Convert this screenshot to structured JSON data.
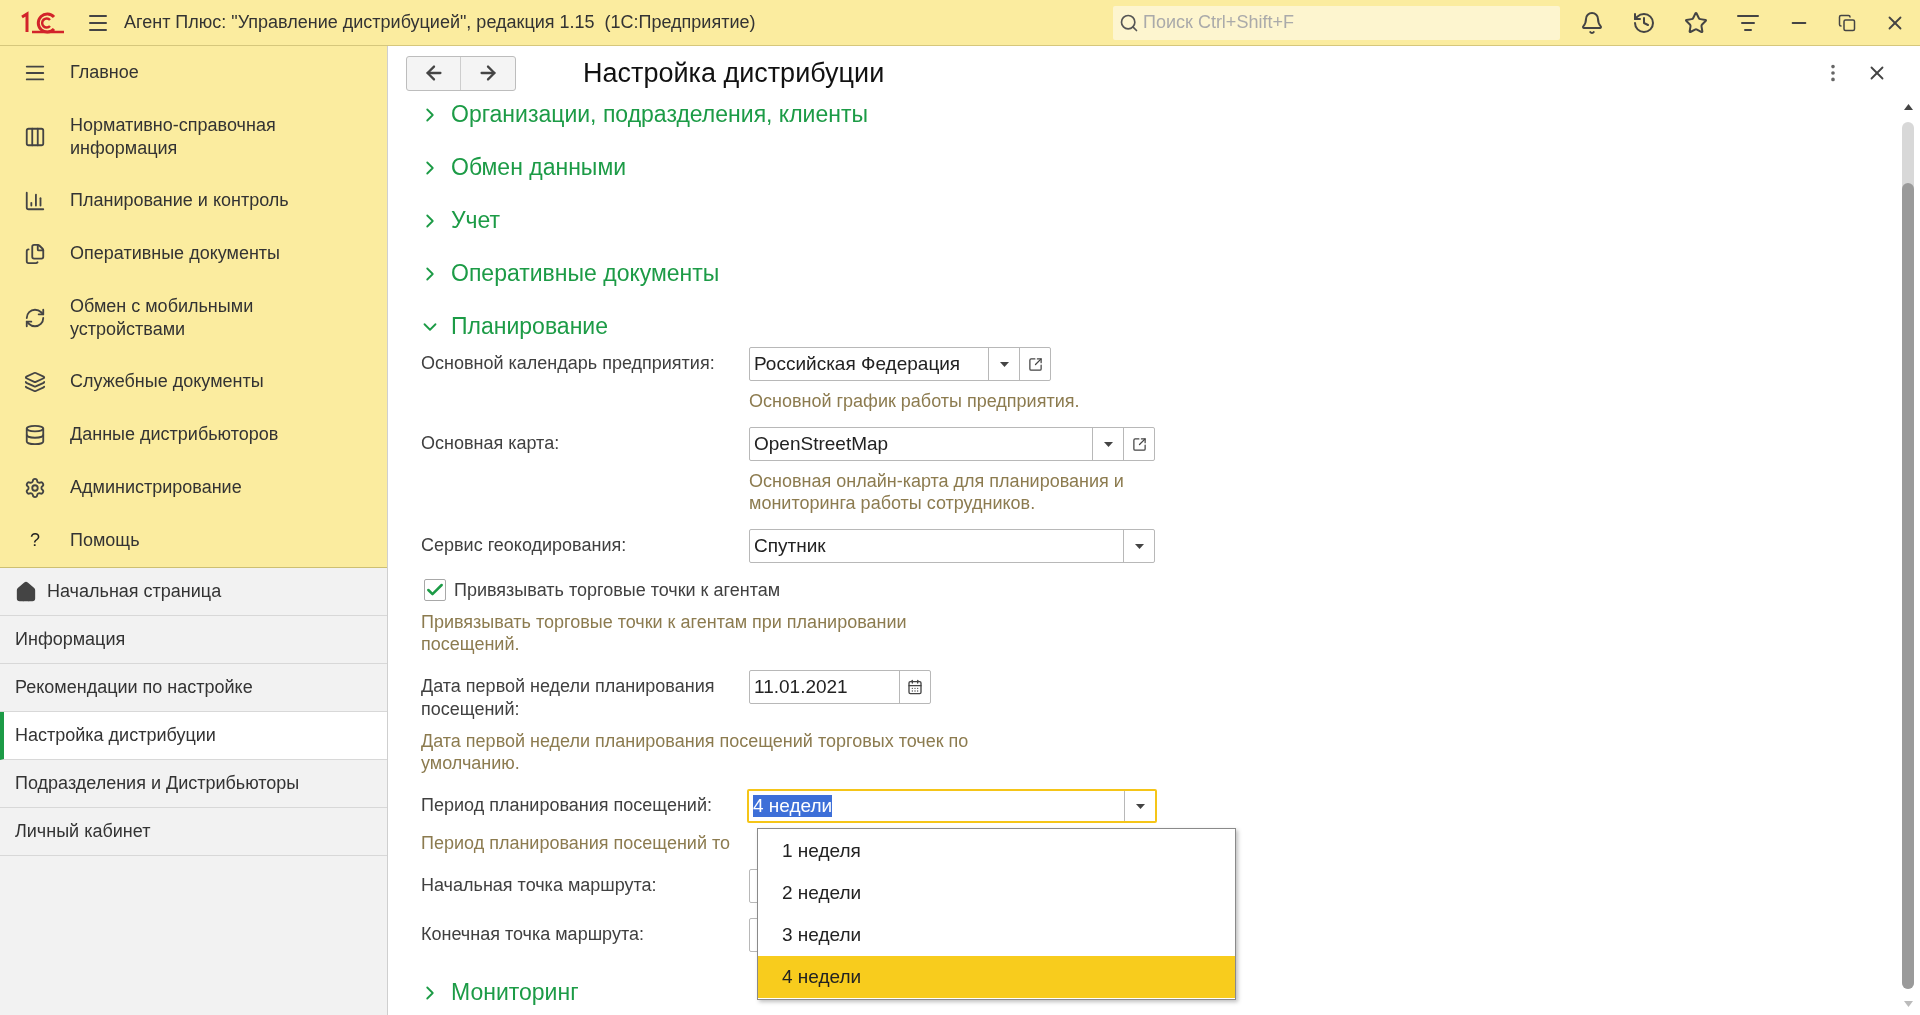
{
  "window": {
    "title": "Агент Плюс: \"Управление дистрибуцией\", редакция 1.15  (1С:Предприятие)",
    "search": {
      "placeholder": "Поиск Ctrl+Shift+F"
    }
  },
  "sidebar": {
    "sections": [
      {
        "label": "Главное"
      },
      {
        "label": "Нормативно-справочная информация"
      },
      {
        "label": "Планирование и контроль"
      },
      {
        "label": "Оперативные документы"
      },
      {
        "label": "Обмен с мобильными устройствами"
      },
      {
        "label": "Служебные документы"
      },
      {
        "label": "Данные дистрибьюторов"
      },
      {
        "label": "Администрирование"
      },
      {
        "label": "Помощь",
        "glyph": "?"
      }
    ],
    "pages": [
      {
        "label": "Начальная страница",
        "selected": false
      },
      {
        "label": "Информация",
        "selected": false
      },
      {
        "label": "Рекомендации по настройке",
        "selected": false
      },
      {
        "label": "Настройка дистрибуции",
        "selected": true
      },
      {
        "label": "Подразделения и Дистрибьюторы",
        "selected": false
      },
      {
        "label": "Личный кабинет",
        "selected": false
      }
    ]
  },
  "form": {
    "title": "Настройка дистрибуции",
    "groups": [
      {
        "title": "Организации, подразделения, клиенты",
        "expanded": false
      },
      {
        "title": "Обмен данными",
        "expanded": false
      },
      {
        "title": "Учет",
        "expanded": false
      },
      {
        "title": "Оперативные документы",
        "expanded": false
      },
      {
        "title": "Планирование",
        "expanded": true,
        "fields": [
          {
            "kind": "select",
            "label": "Основной календарь предприятия:",
            "value": "Российская Федерация",
            "open_button": true,
            "hint": "Основной график работы предприятия."
          },
          {
            "kind": "select",
            "label": "Основная карта:",
            "value": "OpenStreetMap",
            "open_button": true,
            "hint": "Основная онлайн-карта для планирования и мониторинга работы сотрудников."
          },
          {
            "kind": "select",
            "label": "Сервис геокодирования:",
            "value": "Спутник"
          },
          {
            "kind": "checkbox",
            "label": "Привязывать торговые точки к агентам",
            "checked": true,
            "hint": "Привязывать торговые точки к агентам при планировании посещений."
          },
          {
            "kind": "date",
            "label": "Дата первой недели планирования посещений:",
            "value": "11.01.2021",
            "hint": "Дата первой недели планирования посещений торговых точек по умолчанию."
          },
          {
            "kind": "select",
            "label": "Период планирования посещений:",
            "value": "4 недели",
            "focused": true,
            "hint": "Период планирования посещений то",
            "options": [
              {
                "label": "1 неделя",
                "selected": false
              },
              {
                "label": "2 недели",
                "selected": false
              },
              {
                "label": "3 недели",
                "selected": false
              },
              {
                "label": "4 недели",
                "selected": true
              }
            ]
          },
          {
            "kind": "select",
            "label": "Начальная точка маршрута:"
          },
          {
            "kind": "select",
            "label": "Конечная точка маршрута:"
          }
        ]
      },
      {
        "title": "Мониторинг",
        "expanded": false
      }
    ]
  }
}
